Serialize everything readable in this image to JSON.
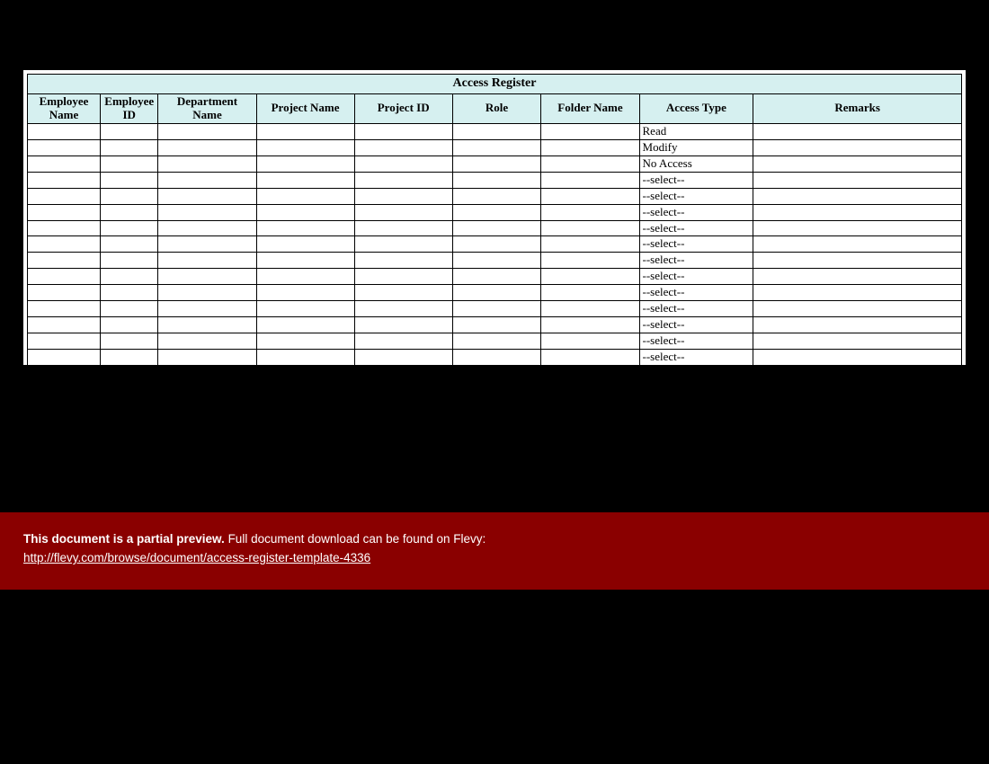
{
  "table": {
    "title": "Access Register",
    "headers": {
      "emp_name": "Employee Name",
      "emp_id": "Employee ID",
      "dept": "Department Name",
      "proj_name": "Project Name",
      "proj_id": "Project ID",
      "role": "Role",
      "folder": "Folder Name",
      "access": "Access Type",
      "remarks": "Remarks"
    },
    "rows": [
      {
        "emp_name": "",
        "emp_id": "",
        "dept": "",
        "proj_name": "",
        "proj_id": "",
        "role": "",
        "folder": "",
        "access": "Read",
        "remarks": ""
      },
      {
        "emp_name": "",
        "emp_id": "",
        "dept": "",
        "proj_name": "",
        "proj_id": "",
        "role": "",
        "folder": "",
        "access": "Modify",
        "remarks": ""
      },
      {
        "emp_name": "",
        "emp_id": "",
        "dept": "",
        "proj_name": "",
        "proj_id": "",
        "role": "",
        "folder": "",
        "access": "No Access",
        "remarks": ""
      },
      {
        "emp_name": "",
        "emp_id": "",
        "dept": "",
        "proj_name": "",
        "proj_id": "",
        "role": "",
        "folder": "",
        "access": "--select--",
        "remarks": ""
      },
      {
        "emp_name": "",
        "emp_id": "",
        "dept": "",
        "proj_name": "",
        "proj_id": "",
        "role": "",
        "folder": "",
        "access": "--select--",
        "remarks": ""
      },
      {
        "emp_name": "",
        "emp_id": "",
        "dept": "",
        "proj_name": "",
        "proj_id": "",
        "role": "",
        "folder": "",
        "access": "--select--",
        "remarks": ""
      },
      {
        "emp_name": "",
        "emp_id": "",
        "dept": "",
        "proj_name": "",
        "proj_id": "",
        "role": "",
        "folder": "",
        "access": "--select--",
        "remarks": ""
      },
      {
        "emp_name": "",
        "emp_id": "",
        "dept": "",
        "proj_name": "",
        "proj_id": "",
        "role": "",
        "folder": "",
        "access": "--select--",
        "remarks": ""
      },
      {
        "emp_name": "",
        "emp_id": "",
        "dept": "",
        "proj_name": "",
        "proj_id": "",
        "role": "",
        "folder": "",
        "access": "--select--",
        "remarks": ""
      },
      {
        "emp_name": "",
        "emp_id": "",
        "dept": "",
        "proj_name": "",
        "proj_id": "",
        "role": "",
        "folder": "",
        "access": "--select--",
        "remarks": ""
      },
      {
        "emp_name": "",
        "emp_id": "",
        "dept": "",
        "proj_name": "",
        "proj_id": "",
        "role": "",
        "folder": "",
        "access": "--select--",
        "remarks": ""
      },
      {
        "emp_name": "",
        "emp_id": "",
        "dept": "",
        "proj_name": "",
        "proj_id": "",
        "role": "",
        "folder": "",
        "access": "--select--",
        "remarks": ""
      },
      {
        "emp_name": "",
        "emp_id": "",
        "dept": "",
        "proj_name": "",
        "proj_id": "",
        "role": "",
        "folder": "",
        "access": "--select--",
        "remarks": ""
      },
      {
        "emp_name": "",
        "emp_id": "",
        "dept": "",
        "proj_name": "",
        "proj_id": "",
        "role": "",
        "folder": "",
        "access": "--select--",
        "remarks": ""
      },
      {
        "emp_name": "",
        "emp_id": "",
        "dept": "",
        "proj_name": "",
        "proj_id": "",
        "role": "",
        "folder": "",
        "access": "--select--",
        "remarks": ""
      }
    ]
  },
  "banner": {
    "lead": "This document is a partial preview.",
    "rest": "  Full document download can be found on Flevy:",
    "link_text": "http://flevy.com/browse/document/access-register-template-4336"
  }
}
